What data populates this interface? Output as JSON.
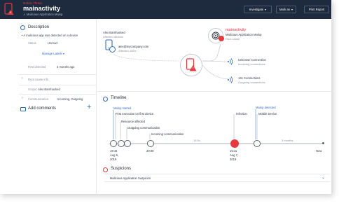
{
  "header": {
    "tag": "Mobile Threat",
    "title": "mainactivity",
    "subtitle": "Malicious Application Malop",
    "buttons": {
      "investigate": "Investigate",
      "mark_as": "Mark as",
      "print_report": "Print Report"
    }
  },
  "description": {
    "title": "Description",
    "bullet": "A malicious app was detected on a device",
    "status_label": "Status",
    "status_value": "Unread",
    "manage_labels": "Manage Labels",
    "first_detected_label": "First detected",
    "first_detected_value": "3 months ago",
    "root_cause_info": "Root cause info",
    "scope_label": "Scope",
    "scope_value": "Alex Barnhacked",
    "communication_label": "Communication",
    "communication_value": "Incoming, Outgoing"
  },
  "comments": {
    "title": "Add comments",
    "add_icon": "plus-icon"
  },
  "graph": {
    "affected_user_name": "Alex Barnhacked",
    "affected_devices_label": "Affected devices",
    "user_email": "alex@mycompany.com",
    "affected_users_label": "Affected users",
    "root_name": "mainactivity",
    "root_sub": "Malicious Application Malop",
    "root_cause_label": "Root cause",
    "conn1_title": "Unknown Connection",
    "conn1_sub": "Incoming connections",
    "conn2_title": "141 Connections",
    "conn2_sub": "Outgoing connections"
  },
  "timeline": {
    "title": "Timeline",
    "malop_started": "Malop started",
    "malop_detected": "Malop detected",
    "events": [
      "First execution on first device",
      "Resource affected",
      "Outgoing communication",
      "Incoming communication"
    ],
    "infection": "Infection",
    "mobile_device": "Mobile Device",
    "gap1": "15:5c",
    "gap2": "3 months",
    "t1_time": "19:44",
    "t1_date": "Aug 6,",
    "t1_year": "2019",
    "t2_time": "20:00",
    "t3_time": "15:11",
    "t3_date": "Aug 7,",
    "t3_year": "2019",
    "now": "Now"
  },
  "suspicions": {
    "title": "Suspicions",
    "row": "Malicious Application Suspicion"
  },
  "colors": {
    "header_bg": "#1e2a3e",
    "accent_red": "#e5393e",
    "accent_blue": "#2f6fc0"
  }
}
